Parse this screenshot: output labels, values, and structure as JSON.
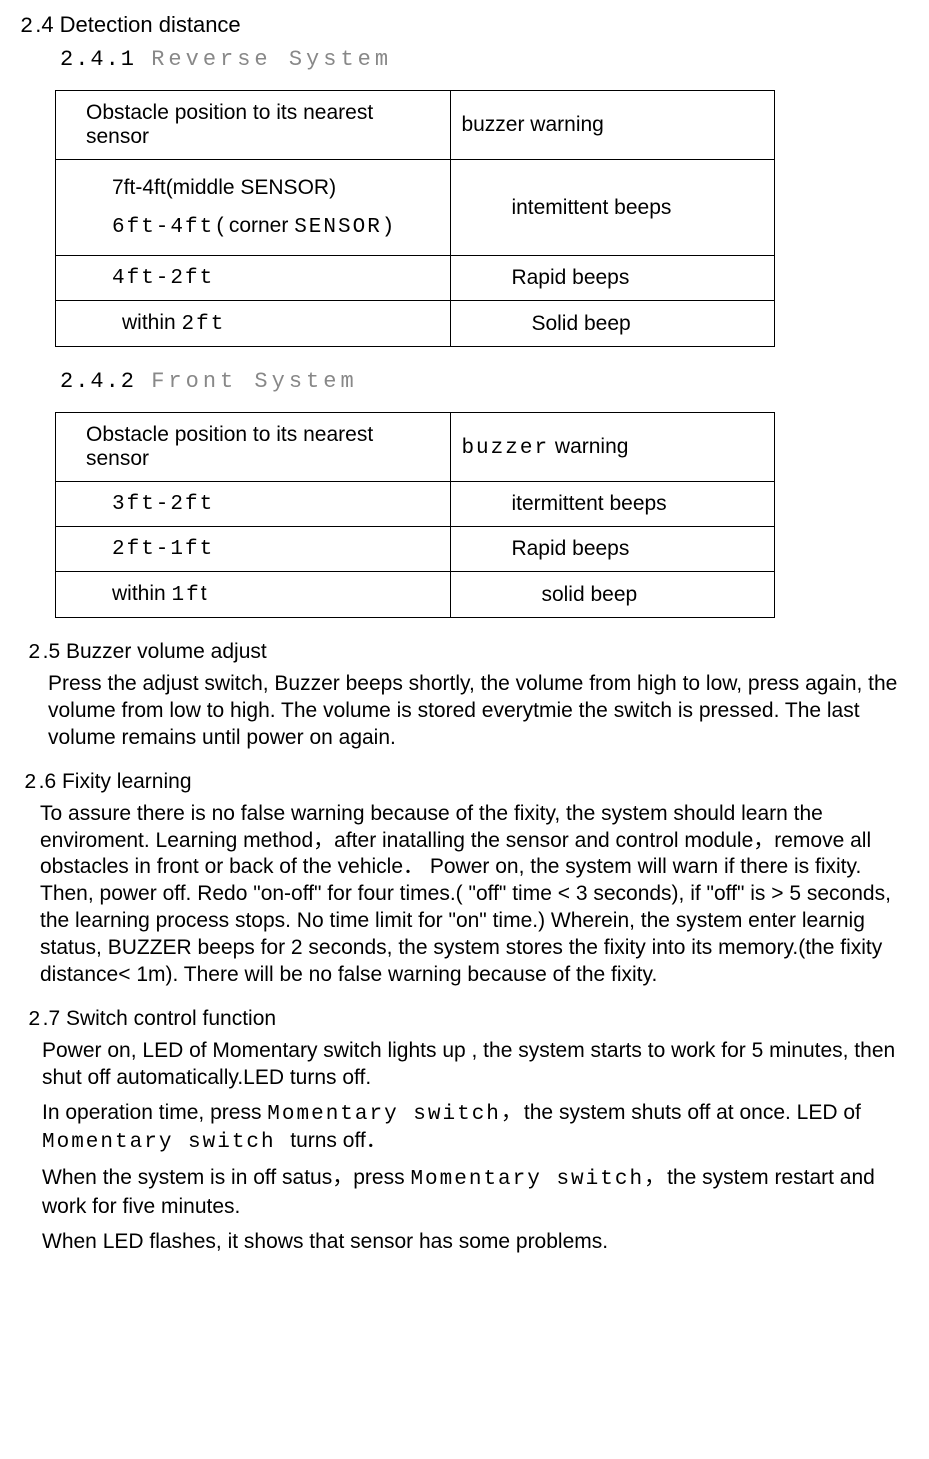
{
  "sec24": {
    "num": "2",
    "title": ".4  Detection distance",
    "sub1_num": "2.4.1",
    "sub1_title": "Reverse System",
    "sub2_num": "2.4.2",
    "sub2_title": "Front System"
  },
  "table1": {
    "h1": "Obstacle position to its nearest sensor",
    "h2": "buzzer warning",
    "r1c1a": "7ft-4ft(middle SENSOR)",
    "r1c1b_a": "6ft-4ft(",
    "r1c1b_b": "corner ",
    "r1c1b_c": "SENSOR)",
    "r1c2": "intemittent beeps",
    "r2c1": "4ft-2ft",
    "r2c2": "Rapid beeps",
    "r3c1a": "within ",
    "r3c1b": "2ft",
    "r3c2": "Solid beep"
  },
  "table2": {
    "h1": "Obstacle position to its nearest sensor",
    "h2a": "buzzer",
    "h2b": "  warning",
    "r1c1": "3ft-2ft",
    "r1c2": "itermittent beeps",
    "r2c1": "2ft-1ft",
    "r2c2": "Rapid beeps",
    "r3c1a": "within ",
    "r3c1b": "1f",
    "r3c1c": "t",
    "r3c2": "solid beep"
  },
  "sec25": {
    "num": "2",
    "title": ".5  Buzzer volume adjust",
    "body": "Press the adjust switch, Buzzer beeps shortly, the volume from high to low, press again, the volume from low to high. The volume is stored everytmie the switch is pressed. The last volume remains until power on again."
  },
  "sec26": {
    "num": "2",
    "title": ".6 Fixity learning",
    "body_a": "To assure there is no false warning because of the fixity, the system should learn the enviroment. Learning method，after inatalling the sensor and control module，remove all obstacles in front or back of the vehicle",
    "body_b": "．",
    "body_c": "  Power on, the system will warn if there is fixity. Then, power off. Redo \"on-off\" for four times.( \"off\" time < 3 seconds), if \"off\"  is > 5 seconds, the learning process stops. No time limit for \"on\" time.) Wherein, the system enter learnig status, BUZZER beeps for 2 seconds, the system stores the fixity into its memory.(the fixity distance< 1m). There will be no false warning because of the fixity."
  },
  "sec27": {
    "num": "2",
    "title": ".7  Switch control function",
    "p1": "Power on, LED of Momentary switch  lights up , the system starts to work for 5 minutes, then shut off automatically.LED turns off.",
    "p2a": "In operation time, press ",
    "p2b": "Momentary switch，",
    "p2c": "the system shuts off at once. LED of ",
    "p2d": "Momentary switch ",
    "p2e": "turns off．",
    "p3a": "When the system is in off satus，press ",
    "p3b": "Momentary switch，",
    "p3c": "the system restart and work for five minutes.",
    "p4": "When LED flashes, it shows that sensor has some problems."
  }
}
